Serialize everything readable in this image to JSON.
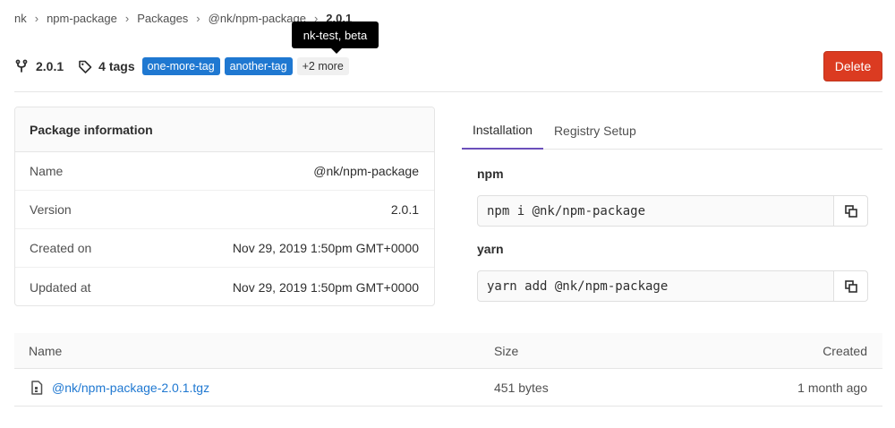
{
  "breadcrumb": {
    "items": [
      "nk",
      "npm-package",
      "Packages",
      "@nk/npm-package"
    ],
    "current": "2.0.1"
  },
  "tooltip": {
    "text": "nk-test, beta"
  },
  "header": {
    "version": "2.0.1",
    "tags_count": "4 tags",
    "tags": [
      "one-more-tag",
      "another-tag"
    ],
    "more_tags": "+2 more",
    "delete_label": "Delete"
  },
  "package_info": {
    "title": "Package information",
    "rows": [
      {
        "label": "Name",
        "value": "@nk/npm-package"
      },
      {
        "label": "Version",
        "value": "2.0.1"
      },
      {
        "label": "Created on",
        "value": "Nov 29, 2019 1:50pm GMT+0000"
      },
      {
        "label": "Updated at",
        "value": "Nov 29, 2019 1:50pm GMT+0000"
      }
    ]
  },
  "tabs": [
    {
      "label": "Installation",
      "active": true
    },
    {
      "label": "Registry Setup",
      "active": false
    }
  ],
  "install": {
    "npm_title": "npm",
    "npm_command": "npm i @nk/npm-package",
    "yarn_title": "yarn",
    "yarn_command": "yarn add @nk/npm-package"
  },
  "files": {
    "columns": {
      "name": "Name",
      "size": "Size",
      "created": "Created"
    },
    "rows": [
      {
        "name": "@nk/npm-package-2.0.1.tgz",
        "size": "451 bytes",
        "created": "1 month ago"
      }
    ]
  },
  "colors": {
    "accent": "#1f78d1",
    "danger": "#db3b21",
    "tab_active": "#6b4fbb"
  },
  "icons": {
    "version": "fork-icon",
    "tags": "tag-icon",
    "copy": "copy-icon",
    "file": "file-archive-icon"
  }
}
